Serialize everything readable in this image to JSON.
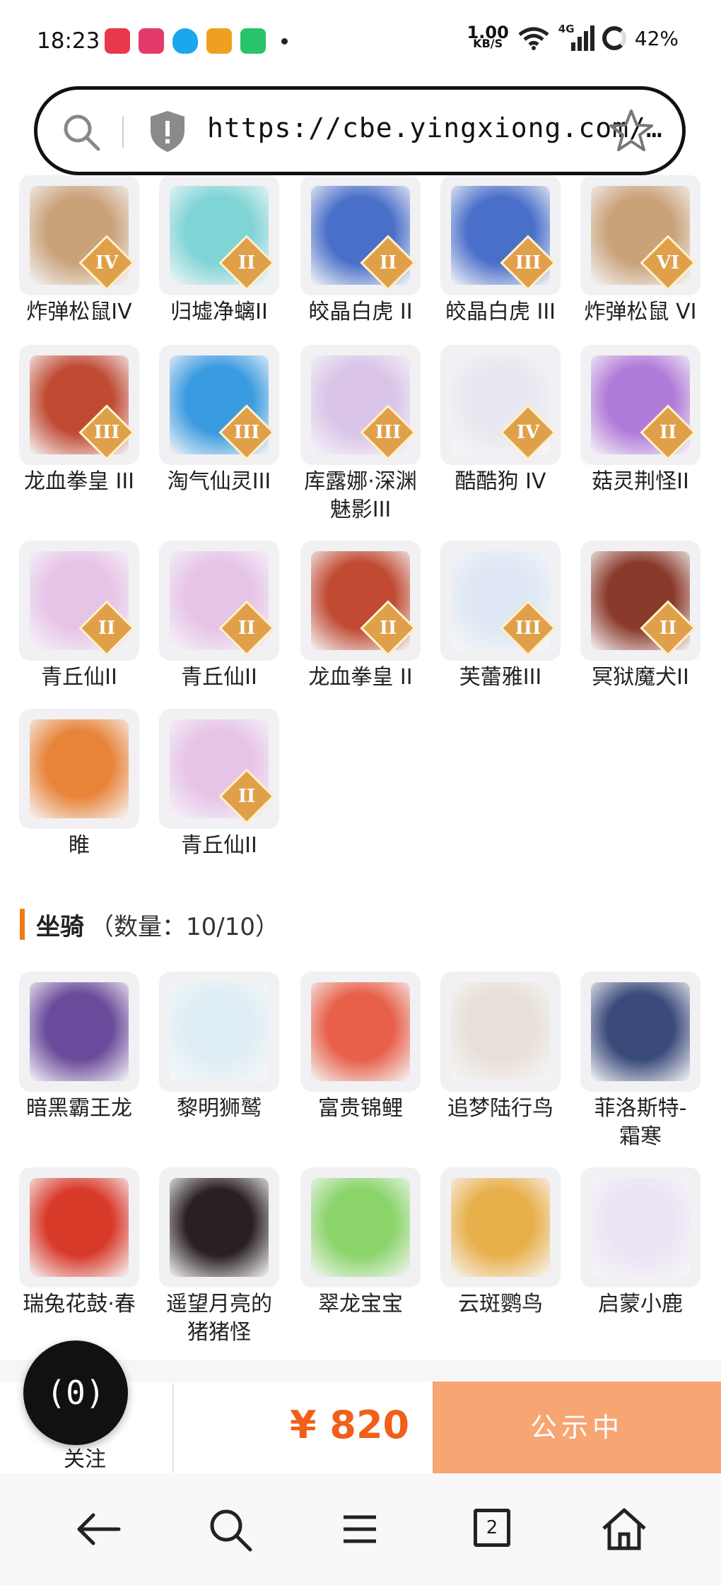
{
  "status_bar": {
    "time": "18:23",
    "net_speed_value": "1.00",
    "net_speed_unit": "KB/S",
    "network": "4G",
    "battery": "42%",
    "app_icons": [
      {
        "name": "red-app-icon",
        "color": "#e8394a"
      },
      {
        "name": "pink-app-icon",
        "color": "#e23b6b"
      },
      {
        "name": "qq-icon",
        "color": "#1aa7ec"
      },
      {
        "name": "orange-app-icon",
        "color": "#f0a020"
      },
      {
        "name": "green-app-icon",
        "color": "#29c36a"
      }
    ]
  },
  "url_bar": {
    "url": "https://cbe.yingxiong.com/…"
  },
  "pets": [
    {
      "label": "炸弹松鼠IV",
      "badge": "IV",
      "color": "#c9a27a"
    },
    {
      "label": "归墟净螭II",
      "badge": "II",
      "color": "#7fd4d6"
    },
    {
      "label": "皎晶白虎 II",
      "badge": "II",
      "color": "#4a6fc9"
    },
    {
      "label": "皎晶白虎 III",
      "badge": "III",
      "color": "#4a6fc9"
    },
    {
      "label": "炸弹松鼠 VI",
      "badge": "VI",
      "color": "#c9a27a"
    },
    {
      "label": "龙血拳皇 III",
      "badge": "III",
      "color": "#c04a32"
    },
    {
      "label": "淘气仙灵III",
      "badge": "III",
      "color": "#3a9be0"
    },
    {
      "label": "库露娜·深渊魅影III",
      "badge": "III",
      "color": "#d9c4e8"
    },
    {
      "label": "酷酷狗 IV",
      "badge": "IV",
      "color": "#e8e8f0"
    },
    {
      "label": "菇灵荆怪II",
      "badge": "II",
      "color": "#b07ad8"
    },
    {
      "label": "青丘仙II",
      "badge": "II",
      "color": "#e6c4e8"
    },
    {
      "label": "青丘仙II",
      "badge": "II",
      "color": "#e6c4e8"
    },
    {
      "label": "龙血拳皇 II",
      "badge": "II",
      "color": "#c04a32"
    },
    {
      "label": "芙蕾雅III",
      "badge": "III",
      "color": "#dfe8f4"
    },
    {
      "label": "冥狱魔犬II",
      "badge": "II",
      "color": "#8a3a2a"
    },
    {
      "label": "睢",
      "badge": "",
      "color": "#e8843a"
    },
    {
      "label": "青丘仙II",
      "badge": "II",
      "color": "#e6c4e8"
    }
  ],
  "mounts_section": {
    "title": "坐骑",
    "count": "（数量：10/10）"
  },
  "mounts": [
    {
      "label": "暗黑霸王龙",
      "color": "#6a4a9a"
    },
    {
      "label": "黎明狮鹫",
      "color": "#dfeef4"
    },
    {
      "label": "富贵锦鲤",
      "color": "#e8604a"
    },
    {
      "label": "追梦陆行鸟",
      "color": "#e8e0d8"
    },
    {
      "label": "菲洛斯特-霜寒",
      "color": "#3a4a7a"
    },
    {
      "label": "瑞兔花鼓·春",
      "color": "#d83a2a"
    },
    {
      "label": "遥望月亮的猪猪怪",
      "color": "#2a2024"
    },
    {
      "label": "翠龙宝宝",
      "color": "#8ad46a"
    },
    {
      "label": "云斑鹦鸟",
      "color": "#e8b04a"
    },
    {
      "label": "启蒙小鹿",
      "color": "#ece4f4"
    }
  ],
  "bottom_bar": {
    "follow_label": "关注",
    "float_label": "(0)",
    "price": "¥ 820",
    "status_button": "公示中",
    "accent": "#f0601a"
  },
  "nav": {
    "tabs_count": "2"
  }
}
